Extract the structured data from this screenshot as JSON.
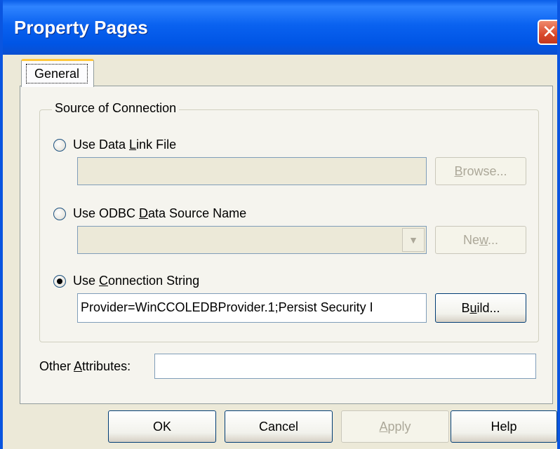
{
  "window": {
    "title": "Property Pages",
    "close_glyph": "✕"
  },
  "tabs": [
    {
      "label": "General"
    }
  ],
  "source_group": {
    "legend": "Source of Connection",
    "data_link": {
      "label": "Use Data Link File",
      "value": "",
      "browse_label": "Browse...",
      "selected": false
    },
    "odbc": {
      "label": "Use ODBC Data Source Name",
      "value": "",
      "new_label": "New...",
      "selected": false
    },
    "connection_string": {
      "label": "Use Connection String",
      "value": "Provider=WinCCOLEDBProvider.1;Persist Security I",
      "build_label": "Build...",
      "selected": true
    }
  },
  "other_attributes": {
    "label": "Other Attributes:",
    "value": ""
  },
  "buttons": {
    "ok": "OK",
    "cancel": "Cancel",
    "apply": "Apply",
    "help": "Help"
  },
  "colors": {
    "titlebar": "#0055e5",
    "dialog_bg": "#ece9d8",
    "close_button": "#d9492d"
  },
  "icons": {
    "close": "close-icon",
    "dropdown": "chevron-down-icon"
  }
}
